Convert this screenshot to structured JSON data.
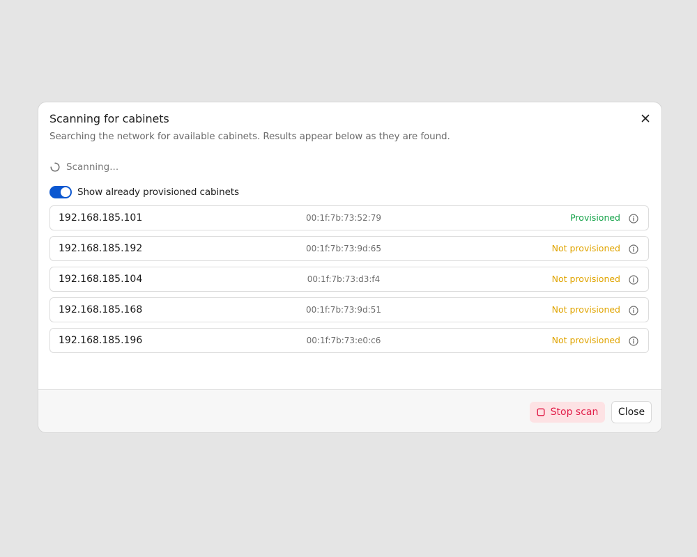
{
  "dialog": {
    "title": "Scanning for cabinets",
    "subtitle": "Searching the network for available cabinets. Results appear below as they are found.",
    "close_icon": "close-icon"
  },
  "scan_status": {
    "text": "Scanning...",
    "icon": "spinner-icon"
  },
  "toggle": {
    "label": "Show already provisioned cabinets",
    "on": true,
    "color": "#0b57d0"
  },
  "cabinets": [
    {
      "ip": "192.168.185.101",
      "mac": "00:1f:7b:73:52:79",
      "status": "Provisioned",
      "status_color": "#16a34a"
    },
    {
      "ip": "192.168.185.192",
      "mac": "00:1f:7b:73:9d:65",
      "status": "Not provisioned",
      "status_color": "#e0a400"
    },
    {
      "ip": "192.168.185.104",
      "mac": "00:1f:7b:73:d3:f4",
      "status": "Not provisioned",
      "status_color": "#e0a400"
    },
    {
      "ip": "192.168.185.168",
      "mac": "00:1f:7b:73:9d:51",
      "status": "Not provisioned",
      "status_color": "#e0a400"
    },
    {
      "ip": "192.168.185.196",
      "mac": "00:1f:7b:73:e0:c6",
      "status": "Not provisioned",
      "status_color": "#e0a400"
    }
  ],
  "footer": {
    "stop_label": "Stop scan",
    "stop_icon": "stop-icon",
    "close_label": "Close"
  },
  "colors": {
    "accent": "#0b57d0",
    "danger": "#e11d48",
    "success": "#16a34a",
    "warning": "#e0a400"
  }
}
